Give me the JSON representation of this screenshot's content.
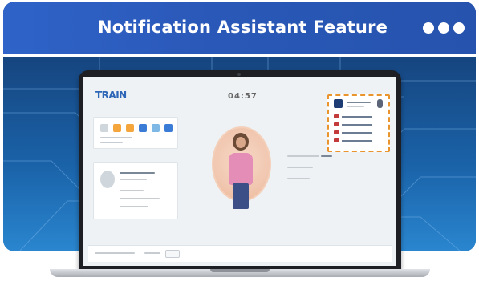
{
  "header": {
    "title": "Notification Assistant Feature",
    "menu_icon": "three-dots-icon"
  },
  "colors": {
    "header_blue": "#2f63c8",
    "accent_orange": "#e9942c",
    "background_blue": "#1a62a8"
  },
  "screen": {
    "logo": "TRAIN",
    "greeting": "04:57"
  }
}
